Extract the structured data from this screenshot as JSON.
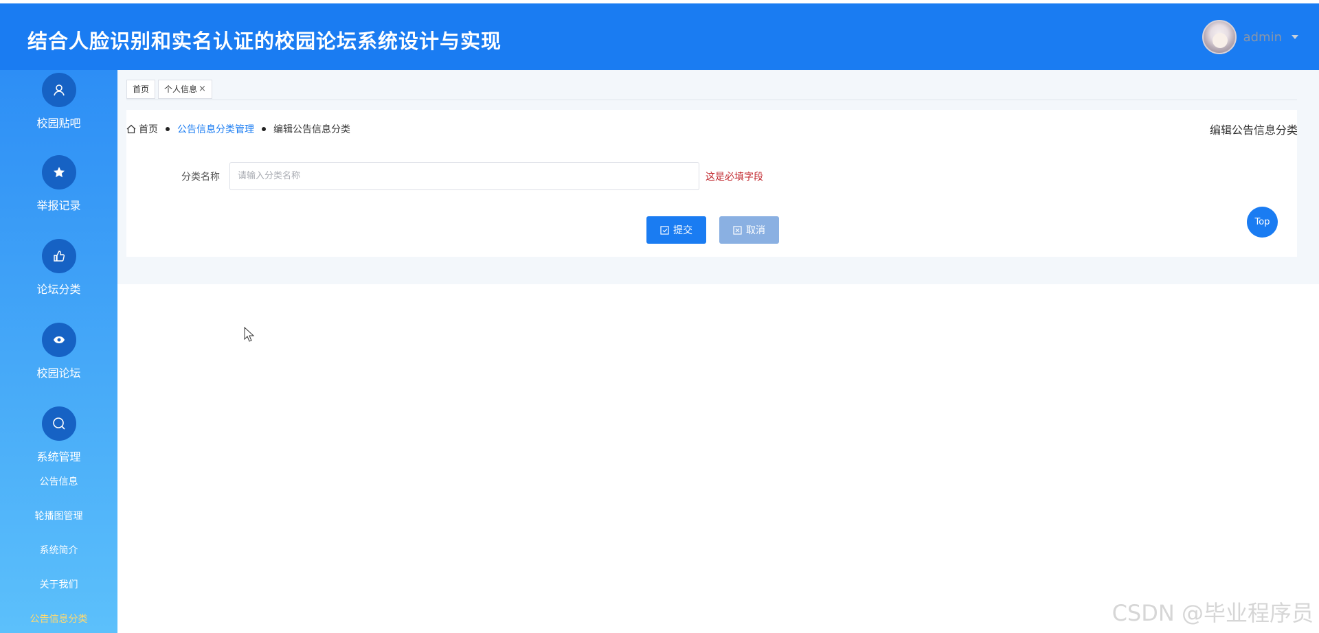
{
  "header": {
    "title": "结合人脸识别和实名认证的校园论坛系统设计与实现",
    "username": "admin"
  },
  "sidebar": {
    "menu": [
      {
        "label": "校园贴吧",
        "icon": "user-icon"
      },
      {
        "label": "举报记录",
        "icon": "star-icon"
      },
      {
        "label": "论坛分类",
        "icon": "thumbs-up-icon"
      },
      {
        "label": "校园论坛",
        "icon": "eye-icon"
      },
      {
        "label": "系统管理",
        "icon": "search-icon"
      }
    ],
    "submenu": [
      {
        "label": "公告信息"
      },
      {
        "label": "轮播图管理"
      },
      {
        "label": "系统简介"
      },
      {
        "label": "关于我们"
      },
      {
        "label": "公告信息分类",
        "active": true
      }
    ]
  },
  "tabs": [
    {
      "label": "首页"
    },
    {
      "label": "个人信息",
      "close": "×"
    }
  ],
  "breadcrumb": {
    "home": "首页",
    "parent": "公告信息分类管理",
    "current": "编辑公告信息分类"
  },
  "page_heading": "编辑公告信息分类",
  "form": {
    "field_label": "分类名称",
    "placeholder": "请输入分类名称",
    "value": "",
    "error": "这是必填字段"
  },
  "buttons": {
    "submit": "提交",
    "cancel": "取消"
  },
  "back_to_top": "Top",
  "watermark": "CSDN @毕业程序员",
  "colors": {
    "primary": "#1a7cf2",
    "sidebar_circle": "#1662c4",
    "active_menu": "#ffd970",
    "error": "#c1272d",
    "cancel": "#8ab0e2"
  }
}
